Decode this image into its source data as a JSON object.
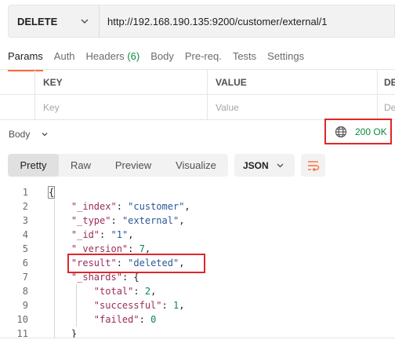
{
  "request": {
    "method": "DELETE",
    "url": "http://192.168.190.135:9200/customer/external/1"
  },
  "request_tabs": [
    {
      "label": "Params",
      "active": true
    },
    {
      "label": "Auth"
    },
    {
      "label": "Headers",
      "count": "(6)"
    },
    {
      "label": "Body"
    },
    {
      "label": "Pre-req."
    },
    {
      "label": "Tests"
    },
    {
      "label": "Settings"
    }
  ],
  "params_table": {
    "headers": [
      "KEY",
      "VALUE",
      "DE"
    ],
    "placeholders": [
      "Key",
      "Value",
      "De"
    ]
  },
  "response": {
    "section_label": "Body",
    "status": "200 OK",
    "status_color": "#0a8a3c",
    "format_tabs": [
      "Pretty",
      "Raw",
      "Preview",
      "Visualize"
    ],
    "active_format": "Pretty",
    "language": "JSON",
    "icons": [
      "chevron-down-icon",
      "globe-icon",
      "wrap-lines-icon"
    ]
  },
  "code_lines": [
    {
      "n": "1",
      "t": "{"
    },
    {
      "n": "2",
      "t": "    \"_index\": \"customer\","
    },
    {
      "n": "3",
      "t": "    \"_type\": \"external\","
    },
    {
      "n": "4",
      "t": "    \"_id\": \"1\","
    },
    {
      "n": "5",
      "t": "    \"_version\": 7,"
    },
    {
      "n": "6",
      "t": "    \"result\": \"deleted\","
    },
    {
      "n": "7",
      "t": "    \"_shards\": {"
    },
    {
      "n": "8",
      "t": "        \"total\": 2,"
    },
    {
      "n": "9",
      "t": "        \"successful\": 1,"
    },
    {
      "n": "10",
      "t": "        \"failed\": 0"
    },
    {
      "n": "11",
      "t": "    }"
    }
  ],
  "colors": {
    "accent": "#ff6c37",
    "highlight_border": "#e0262a",
    "json_key": "#9b2c5a",
    "json_string": "#2b5797",
    "json_number": "#098658"
  }
}
